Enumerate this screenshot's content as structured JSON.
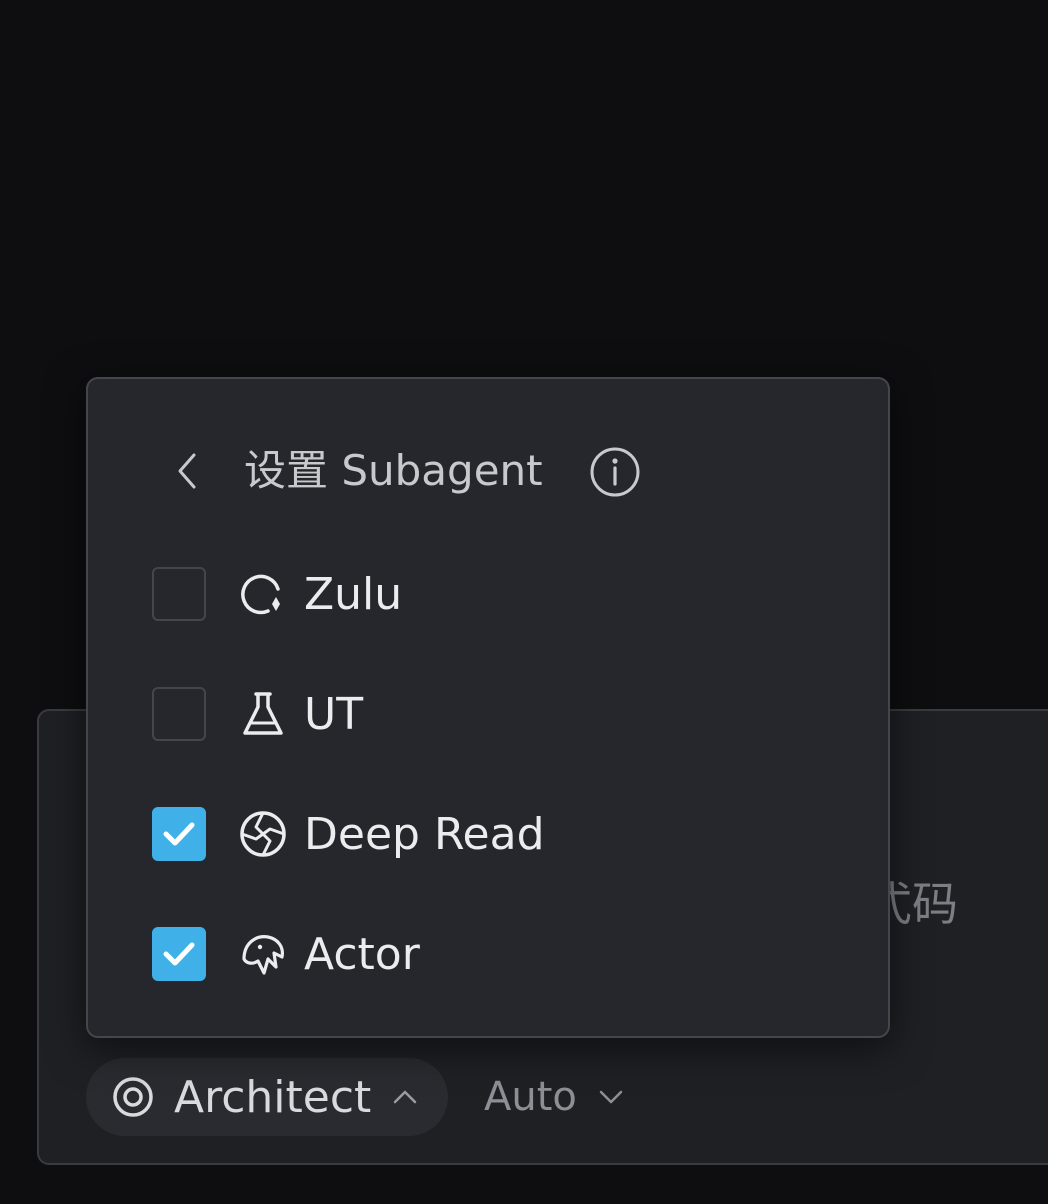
{
  "popup": {
    "title": "设置 Subagent",
    "options": [
      {
        "label": "Zulu",
        "checked": false,
        "icon": "zulu-swirl-icon"
      },
      {
        "label": "UT",
        "checked": false,
        "icon": "flask-icon"
      },
      {
        "label": "Deep Read",
        "checked": true,
        "icon": "aperture-icon"
      },
      {
        "label": "Actor",
        "checked": true,
        "icon": "bird-icon"
      }
    ]
  },
  "input_panel": {
    "placeholder_fragment": "弌码"
  },
  "toolbar": {
    "agent_label": "Architect",
    "agent_icon": "target-icon",
    "mode_label": "Auto"
  },
  "colors": {
    "background": "#0e0e10",
    "popup_bg": "#26272c",
    "checkbox_accent": "#3fb1e8"
  }
}
